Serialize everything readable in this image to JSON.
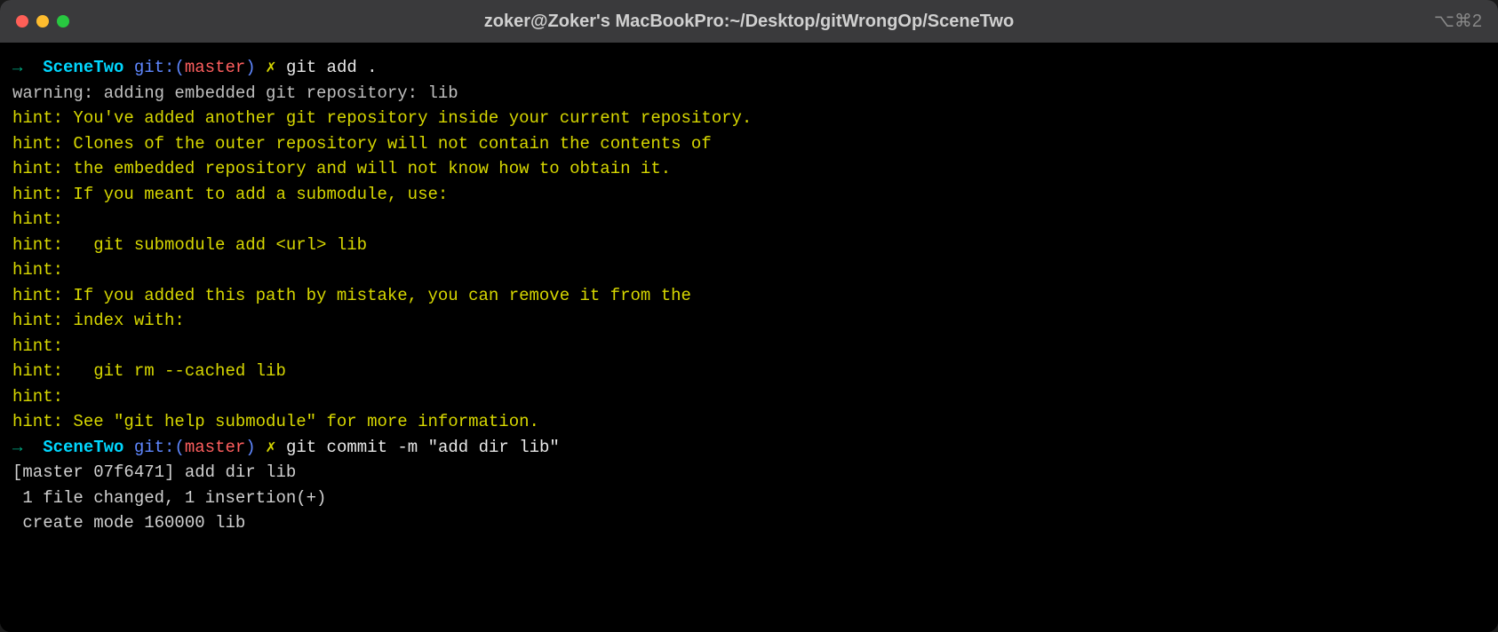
{
  "titlebar": {
    "title": "zoker@Zoker's MacBookPro:~/Desktop/gitWrongOp/SceneTwo",
    "shortcut": "⌥⌘2"
  },
  "prompt": {
    "arrow": "→",
    "dir": "SceneTwo",
    "git_label": "git:(",
    "branch": "master",
    "git_close": ")",
    "mark": "✗"
  },
  "cmd1": "git add .",
  "cmd2": "git commit -m \"add dir lib\"",
  "out": {
    "warn": "warning: adding embedded git repository: lib",
    "h1": "hint: You've added another git repository inside your current repository.",
    "h2": "hint: Clones of the outer repository will not contain the contents of",
    "h3": "hint: the embedded repository and will not know how to obtain it.",
    "h4": "hint: If you meant to add a submodule, use:",
    "h5": "hint:",
    "h6": "hint:   git submodule add <url> lib",
    "h7": "hint:",
    "h8": "hint: If you added this path by mistake, you can remove it from the",
    "h9": "hint: index with:",
    "h10": "hint:",
    "h11": "hint:   git rm --cached lib",
    "h12": "hint:",
    "h13": "hint: See \"git help submodule\" for more information.",
    "c1": "[master 07f6471] add dir lib",
    "c2": " 1 file changed, 1 insertion(+)",
    "c3": " create mode 160000 lib"
  }
}
